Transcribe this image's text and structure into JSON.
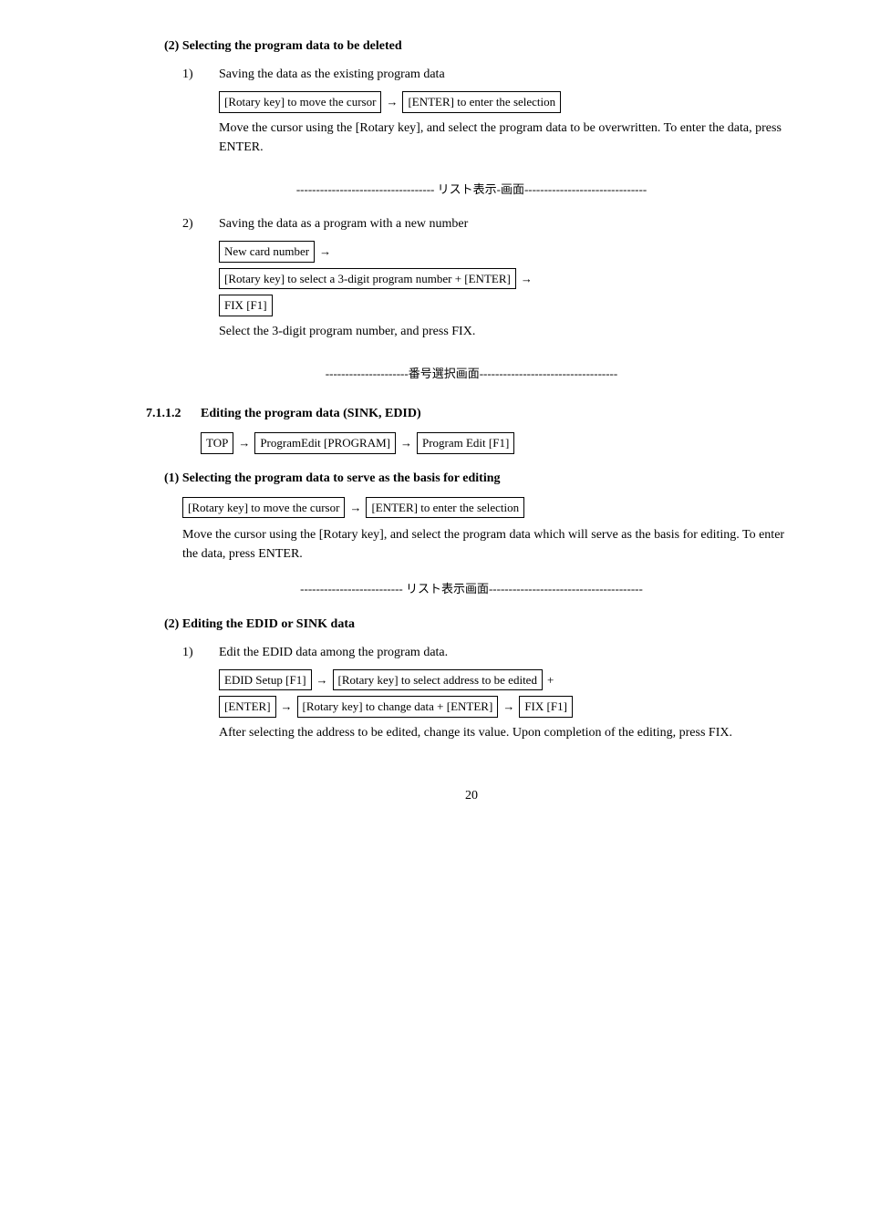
{
  "sections": {
    "select_delete": {
      "heading": "(2)   Selecting the program data to be deleted",
      "item1": {
        "num": "1)",
        "label": "Saving the data as the existing program data",
        "seq1_box1": "[Rotary key] to move the cursor",
        "seq1_arrow": "→",
        "seq1_box2": "[ENTER] to enter the selection",
        "para": "Move the cursor using the [Rotary key], and select the program data to be overwritten.    To enter the data, press ENTER."
      },
      "divider1": "----------------------------------- リスト表示-画面-------------------------------",
      "item2": {
        "num": "2)",
        "label": "Saving the data as a program with a new number",
        "seq1_box1": "New card number",
        "seq1_arrow": "→",
        "seq2_box1": "[Rotary key] to select a 3-digit program number + [ENTER]",
        "seq2_arrow": "→",
        "seq3_box1": "FIX [F1]",
        "para": "Select the 3-digit program number, and press FIX."
      },
      "divider2": "---------------------番号選択画面-----------------------------------"
    },
    "editing": {
      "num": "7.1.1.2",
      "title": "Editing the program data (SINK, EDID)",
      "path_box1": "TOP",
      "path_arrow1": "→",
      "path_box2": "ProgramEdit [PROGRAM]",
      "path_arrow2": "→",
      "path_box3": "Program Edit [F1]",
      "select_basis": {
        "heading": "(1)   Selecting the program data to serve as the basis for editing",
        "seq1_box1": "[Rotary key] to move the cursor",
        "seq1_arrow": "→",
        "seq1_box2": "[ENTER] to enter the selection",
        "para": "Move the cursor using the [Rotary key], and select the program data which will serve as the basis for editing.    To enter the data, press ENTER."
      },
      "divider3": "-------------------------- リスト表示画面---------------------------------------",
      "edit_edid": {
        "heading": "(2)   Editing the EDID or SINK data",
        "item1": {
          "num": "1)",
          "label": "Edit the EDID data among the program data.",
          "seq1_box1": "EDID Setup [F1]",
          "seq1_arrow": "→",
          "seq1_box2": "[Rotary key] to select address to be edited",
          "seq1_plus": "+",
          "seq2_box1": "[ENTER]",
          "seq2_arrow": "→",
          "seq2_box2": "[Rotary key] to change data + [ENTER]",
          "seq2_arrow2": "→",
          "seq2_box3": "FIX [F1]",
          "para": "After selecting the address to be edited, change its value.    Upon completion of the editing, press FIX."
        }
      }
    }
  },
  "page_number": "20"
}
